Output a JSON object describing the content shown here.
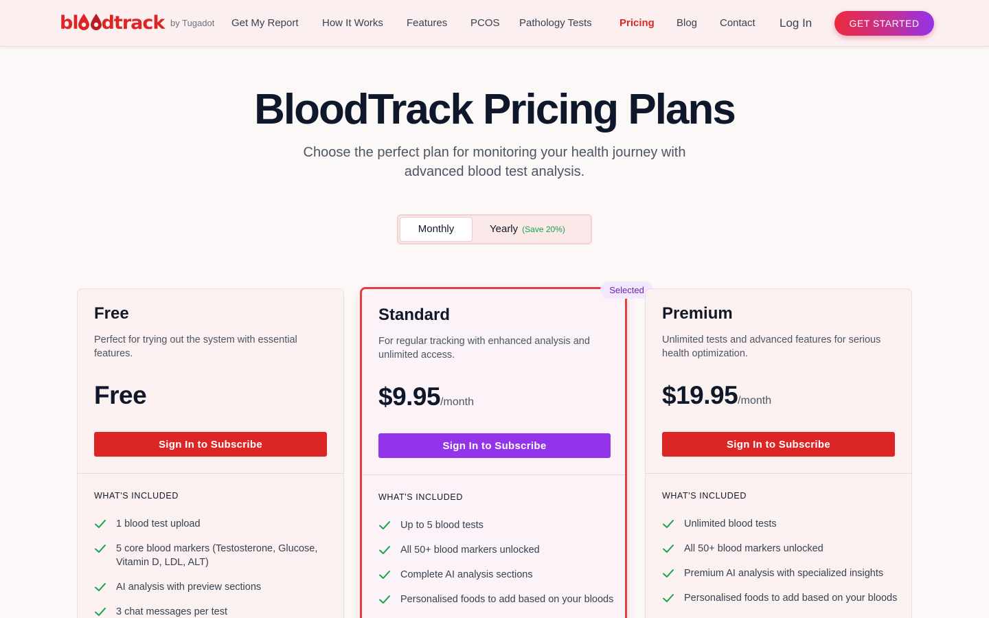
{
  "nav": {
    "logo_text": "bloodtrack",
    "logo_by": "by Tugadot",
    "links": [
      {
        "label": "Get My Report",
        "active": false
      },
      {
        "label": "How It Works",
        "active": false
      },
      {
        "label": "Features",
        "active": false
      },
      {
        "label": "PCOS",
        "active": false
      },
      {
        "label": "Pathology Tests",
        "active": false
      },
      {
        "label": "Pricing",
        "active": true
      },
      {
        "label": "Blog",
        "active": false
      },
      {
        "label": "Contact",
        "active": false
      }
    ],
    "login_label": "Log In",
    "cta_label": "GET STARTED"
  },
  "hero": {
    "title": "BloodTrack Pricing Plans",
    "subtitle": "Choose the perfect plan for monitoring your health journey with advanced blood test analysis."
  },
  "billing_toggle": {
    "monthly_label": "Monthly",
    "yearly_label": "Yearly",
    "yearly_save": "(Save 20%)",
    "selected": "Monthly"
  },
  "plans": [
    {
      "name": "Free",
      "description": "Perfect for trying out the system with essential features.",
      "price": "Free",
      "period": "",
      "button_label": "Sign In to Subscribe",
      "included_title": "WHAT'S INCLUDED",
      "features": [
        "1 blood test upload",
        "5 core blood markers (Testosterone, Glucose, Vitamin D, LDL, ALT)",
        "AI analysis with preview sections",
        "3 chat messages per test"
      ]
    },
    {
      "name": "Standard",
      "badge": "Selected",
      "description": "For regular tracking with enhanced analysis and unlimited access.",
      "price": "$9.95",
      "period": "/month",
      "button_label": "Sign In to Subscribe",
      "included_title": "WHAT'S INCLUDED",
      "features": [
        "Up to 5 blood tests",
        "All 50+ blood markers unlocked",
        "Complete AI analysis sections",
        "Personalised foods to add based on your bloods"
      ]
    },
    {
      "name": "Premium",
      "description": "Unlimited tests and advanced features for serious health optimization.",
      "price": "$19.95",
      "period": "/month",
      "button_label": "Sign In to Subscribe",
      "included_title": "WHAT'S INCLUDED",
      "features": [
        "Unlimited blood tests",
        "All 50+ blood markers unlocked",
        "Premium AI analysis with specialized insights",
        "Personalised foods to add based on your bloods"
      ]
    }
  ],
  "colors": {
    "brand_red": "#dc2626",
    "accent_purple": "#9333ea",
    "check_green": "#16a34a"
  }
}
